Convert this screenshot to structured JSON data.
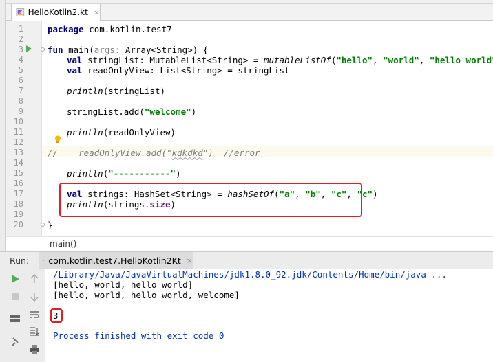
{
  "editor_tab": {
    "label": "HelloKotlin2.kt",
    "close": "×"
  },
  "line_numbers": [
    "1",
    "2",
    "3",
    "4",
    "5",
    "6",
    "7",
    "8",
    "9",
    "10",
    "11",
    "12",
    "13",
    "14",
    "15",
    "16",
    "17",
    "18",
    "19",
    "20"
  ],
  "code": {
    "l1_kw": "package",
    "l1_rest": " com.kotlin.test7",
    "l3_kw": "fun",
    "l3_name": " main(",
    "l3_param": "args: ",
    "l3_rest": "Array<String>) {",
    "l4_kw": "val",
    "l4_a": " stringList: MutableList<String> = ",
    "l4_fn": "mutableListOf",
    "l4_p": "(",
    "l4_s1": "\"hello\"",
    "l4_c1": ", ",
    "l4_s2": "\"world\"",
    "l4_c2": ", ",
    "l4_s3": "\"hello world\"",
    "l4_end": ")",
    "l5_kw": "val",
    "l5_rest": " readOnlyView: List<String> = stringList",
    "l7_fn": "println",
    "l7_rest": "(stringList)",
    "l9_a": "stringList.add(",
    "l9_s": "\"welcome\"",
    "l9_end": ")",
    "l11_fn": "println",
    "l11_rest": "(readOnlyView)",
    "l13_c1": "//    readOnlyView.add(\"",
    "l13_u": "kdkdkd",
    "l13_c2": "\")  //error",
    "l15_fn": "println",
    "l15_p": "(",
    "l15_s": "\"-----------\"",
    "l15_end": ")",
    "l17_kw": "val",
    "l17_a": " strings: HashSet<String> = ",
    "l17_fn": "hashSetOf",
    "l17_p": "(",
    "l17_s1": "\"a\"",
    "l17_c1": ", ",
    "l17_s2": "\"b\"",
    "l17_c2": ", ",
    "l17_s3": "\"c\"",
    "l17_c3": ", ",
    "l17_s4": "\"c\"",
    "l17_end": ")",
    "l18_fn": "println",
    "l18_a": "(strings.",
    "l18_prop": "size",
    "l18_end": ")",
    "l20": "}"
  },
  "breadcrumb": "main()",
  "run_panel": {
    "label": "Run:",
    "tab_label": "com.kotlin.test7.HelloKotlin2Kt",
    "tab_close": "×"
  },
  "console": {
    "path": "/Library/Java/JavaVirtualMachines/jdk1.8.0_92.jdk/Contents/Home/bin/java ...",
    "out1": "[hello, world, hello world]",
    "out2": "[hello, world, hello world, welcome]",
    "out3": "-----------",
    "out4": "3",
    "finish": "Process finished with exit code 0"
  },
  "colors": {
    "keyword": "#000080",
    "string": "#008000",
    "highlight": "#e02020",
    "run_arrow": "#4caf50"
  }
}
